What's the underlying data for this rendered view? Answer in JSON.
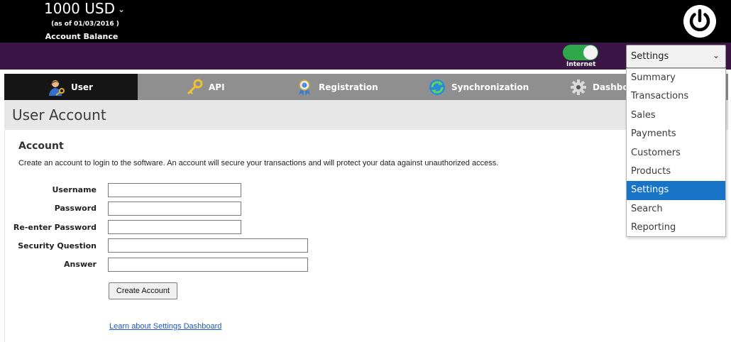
{
  "header": {
    "balance_amount": "1000 USD",
    "balance_date": "(as of 01/03/2016 )",
    "balance_label": "Account Balance"
  },
  "status": {
    "internet_label": "Internet",
    "internet_on": true
  },
  "view_select": {
    "value": "Settings",
    "options": [
      "Summary",
      "Transactions",
      "Sales",
      "Payments",
      "Customers",
      "Products",
      "Settings",
      "Search",
      "Reporting"
    ],
    "selected_index": 6
  },
  "tabs": [
    {
      "label": "User",
      "icon": "user-key-icon",
      "active": true
    },
    {
      "label": "API",
      "icon": "key-icon",
      "active": false
    },
    {
      "label": "Registration",
      "icon": "ribbon-icon",
      "active": false
    },
    {
      "label": "Synchronization",
      "icon": "sync-icon",
      "active": false
    },
    {
      "label": "Dashboa",
      "icon": "gear-icon",
      "active": false
    }
  ],
  "page": {
    "title": "User Account",
    "section_heading": "Account",
    "section_description": "Create an account to login to the software. An account will secure your transactions and will protect your data against unauthorized access."
  },
  "form": {
    "fields": [
      {
        "label": "Username",
        "value": ""
      },
      {
        "label": "Password",
        "value": ""
      },
      {
        "label": "Re-enter Password",
        "value": ""
      },
      {
        "label": "Security Question",
        "value": ""
      },
      {
        "label": "Answer",
        "value": ""
      }
    ],
    "submit_label": "Create Account",
    "help_link": "Learn about Settings Dashboard"
  },
  "colors": {
    "header_bg": "#000000",
    "purple_strip": "#3a1545",
    "toggle_on": "#2ea84b",
    "selected_item": "#1874c7",
    "tab_bar": "#8f8f8f",
    "tab_active": "#161616",
    "link": "#1a57c9"
  }
}
